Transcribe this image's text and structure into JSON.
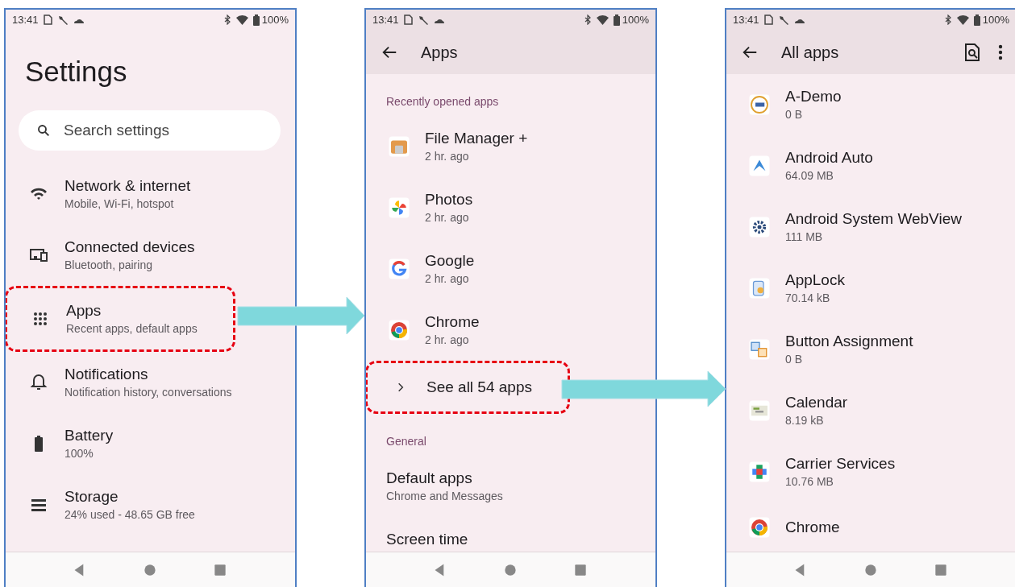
{
  "screens": [
    {
      "kind": "home",
      "status": {
        "time": "13:41",
        "battery": "100%"
      },
      "title": "Settings",
      "search": {
        "placeholder": "Search settings"
      },
      "items": [
        {
          "kind": "setting",
          "title": "Network & internet",
          "subtitle": "Mobile, Wi-Fi, hotspot",
          "highlighted": false
        },
        {
          "kind": "setting",
          "title": "Connected devices",
          "subtitle": "Bluetooth, pairing",
          "highlighted": false
        },
        {
          "kind": "setting",
          "title": "Apps",
          "subtitle": "Recent apps, default apps",
          "highlighted": true
        },
        {
          "kind": "setting",
          "title": "Notifications",
          "subtitle": "Notification history, conversations",
          "highlighted": false
        },
        {
          "kind": "setting",
          "title": "Battery",
          "subtitle": "100%",
          "highlighted": false
        },
        {
          "kind": "setting",
          "title": "Storage",
          "subtitle": "24% used - 48.65 GB free",
          "highlighted": false
        }
      ]
    },
    {
      "kind": "page",
      "status": {
        "time": "13:41",
        "battery": "100%"
      },
      "title": "Apps",
      "items": [
        {
          "kind": "section",
          "title": "Recently opened apps",
          "highlighted": false
        },
        {
          "kind": "app",
          "title": "File Manager +",
          "subtitle": "2 hr. ago",
          "highlighted": false
        },
        {
          "kind": "app",
          "title": "Photos",
          "subtitle": "2 hr. ago",
          "highlighted": false
        },
        {
          "kind": "app",
          "title": "Google",
          "subtitle": "2 hr. ago",
          "highlighted": false
        },
        {
          "kind": "app",
          "title": "Chrome",
          "subtitle": "2 hr. ago",
          "highlighted": false
        },
        {
          "kind": "link",
          "title": "See all 54 apps",
          "highlighted": true
        },
        {
          "kind": "section",
          "title": "General",
          "highlighted": false
        },
        {
          "kind": "plain",
          "title": "Default apps",
          "subtitle": "Chrome and Messages",
          "highlighted": false
        },
        {
          "kind": "plain",
          "title": "Screen time",
          "highlighted": false
        }
      ]
    },
    {
      "kind": "app_list",
      "status": {
        "time": "13:41",
        "battery": "100%"
      },
      "title": "All apps",
      "items": [
        {
          "kind": "app",
          "title": "A-Demo",
          "subtitle": "0 B",
          "highlighted": false
        },
        {
          "kind": "app",
          "title": "Android Auto",
          "subtitle": "64.09 MB",
          "highlighted": false
        },
        {
          "kind": "app",
          "title": "Android System WebView",
          "subtitle": "111 MB",
          "highlighted": false
        },
        {
          "kind": "app",
          "title": "AppLock",
          "subtitle": "70.14 kB",
          "highlighted": false
        },
        {
          "kind": "app",
          "title": "Button Assignment",
          "subtitle": "0 B",
          "highlighted": false
        },
        {
          "kind": "app",
          "title": "Calendar",
          "subtitle": "8.19 kB",
          "highlighted": false
        },
        {
          "kind": "app",
          "title": "Carrier Services",
          "subtitle": "10.76 MB",
          "highlighted": false
        },
        {
          "kind": "app",
          "title": "Chrome",
          "highlighted": false
        }
      ]
    }
  ]
}
